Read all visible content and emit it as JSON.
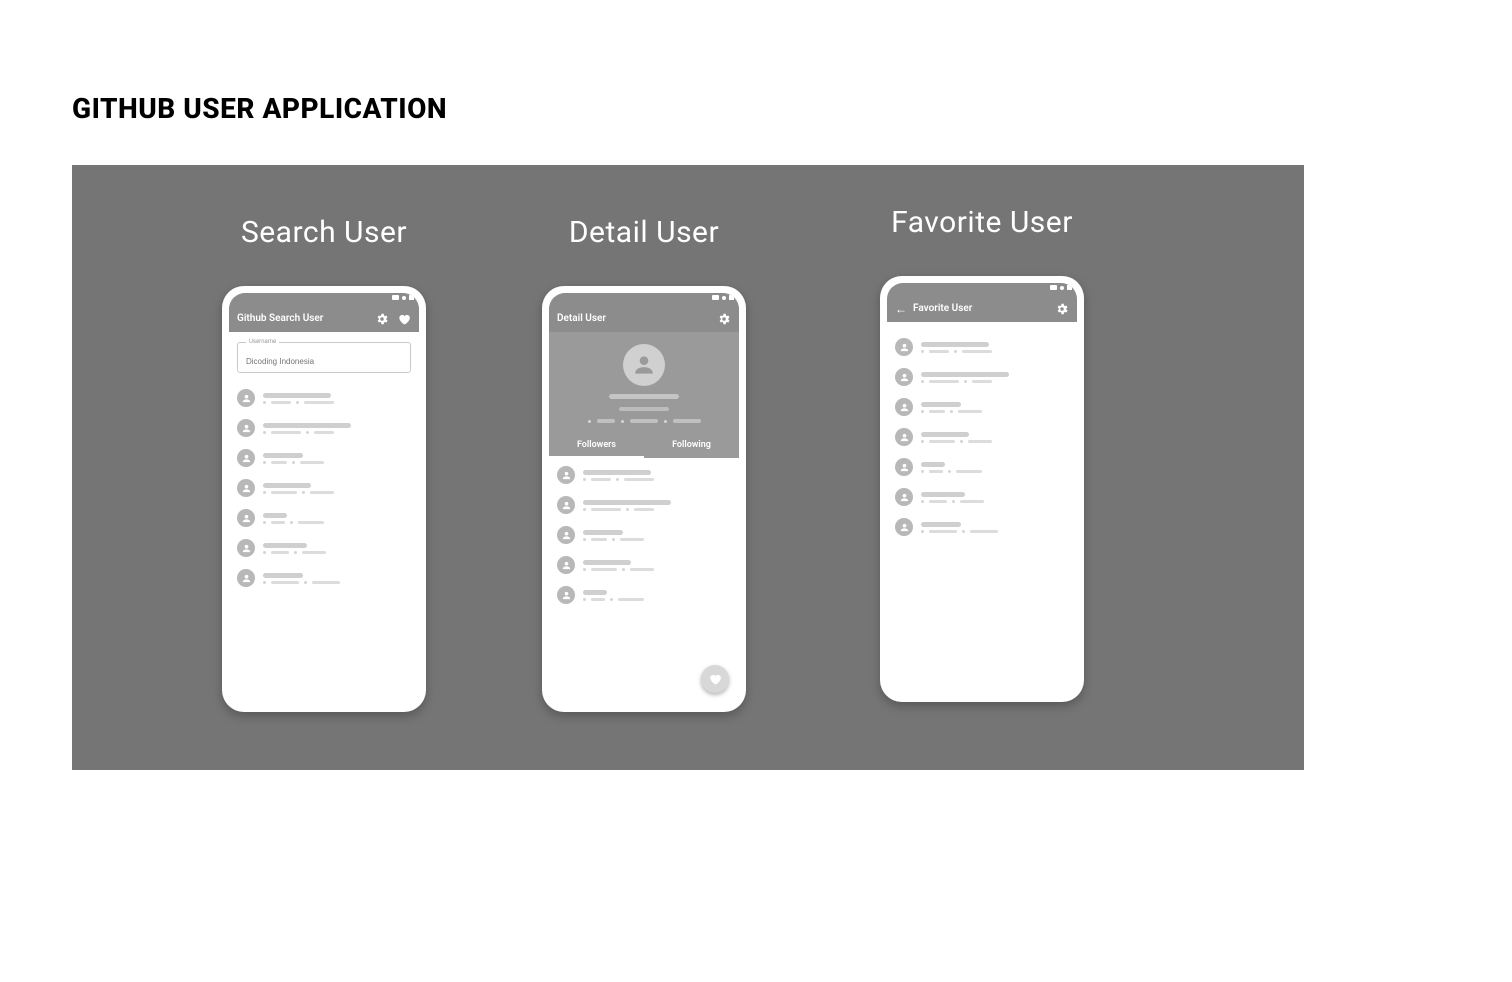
{
  "page_title": "GITHUB USER APPLICATION",
  "screens": {
    "search": {
      "heading": "Search User",
      "appbar_title": "Github Search User",
      "search_legend": "Username",
      "search_placeholder": "Dicoding Indonesia",
      "list_count": 7
    },
    "detail": {
      "heading": "Detail User",
      "appbar_title": "Detail User",
      "tabs": {
        "followers": "Followers",
        "following": "Following"
      },
      "list_count": 5
    },
    "favorite": {
      "heading": "Favorite User",
      "appbar_title": "Favorite User",
      "list_count": 7
    }
  }
}
